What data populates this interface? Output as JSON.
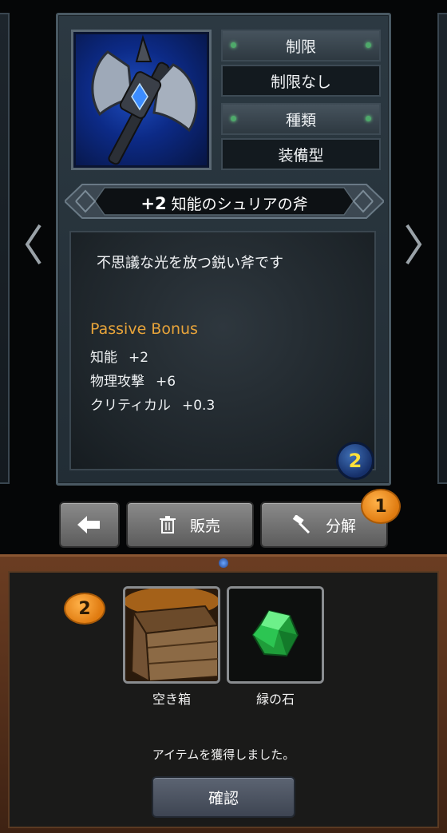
{
  "item": {
    "restriction_label": "制限",
    "restriction_value": "制限なし",
    "type_label": "種類",
    "type_value": "装備型",
    "plus": "+2",
    "name": "知能のシュリアの斧",
    "description": "不思議な光を放つ鋭い斧です",
    "passive_title": "Passive Bonus",
    "bonuses": [
      {
        "stat": "知能",
        "value": "+2"
      },
      {
        "stat": "物理攻撃",
        "value": "+6"
      },
      {
        "stat": "クリティカル",
        "value": "+0.3"
      }
    ],
    "count_badge": "2",
    "icon": "battle-axe-icon"
  },
  "actions": {
    "back_icon": "back-arrow-icon",
    "sell_label": "販売",
    "sell_icon": "trash-icon",
    "disassemble_label": "分解",
    "disassemble_icon": "hammer-icon",
    "step1_badge": "1"
  },
  "result": {
    "step2_badge": "2",
    "items": [
      {
        "label": "空き箱",
        "icon": "empty-box-icon"
      },
      {
        "label": "緑の石",
        "icon": "green-stone-icon"
      }
    ],
    "message": "アイテムを獲得しました。",
    "confirm_label": "確認"
  },
  "colors": {
    "bonus_title": "#e8a43a",
    "badge_number": "#ffe03a",
    "step_badge": "#f29a22"
  }
}
